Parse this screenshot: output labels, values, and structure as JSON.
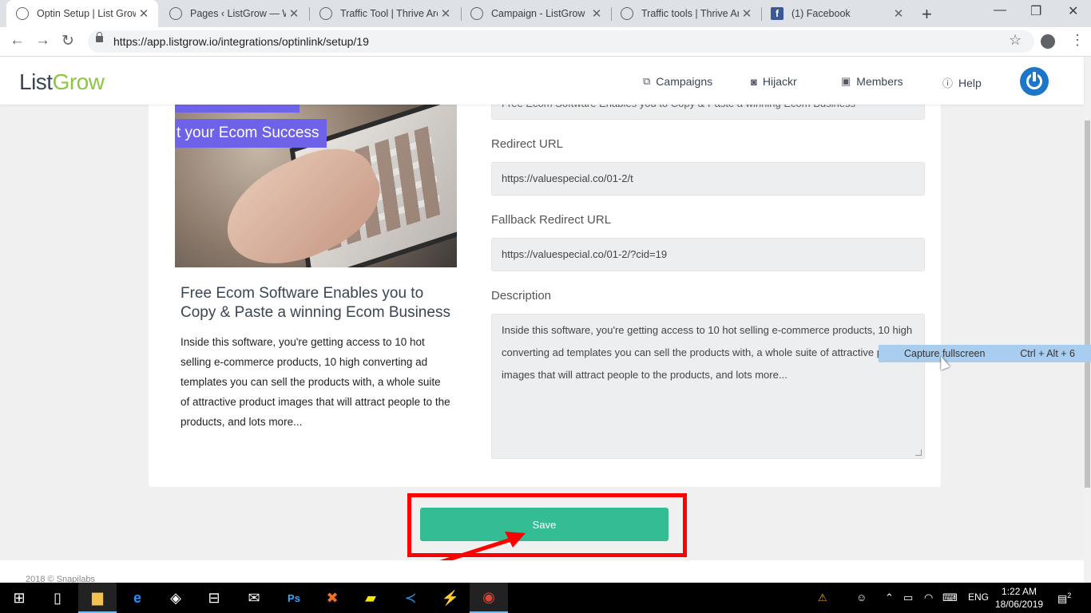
{
  "browser": {
    "tabs": [
      {
        "title": "Optin Setup | List Grow"
      },
      {
        "title": "Pages ‹ ListGrow — Wo"
      },
      {
        "title": "Traffic Tool | Thrive Arch"
      },
      {
        "title": "Campaign - ListGrow"
      },
      {
        "title": "Traffic tools | Thrive Arch"
      },
      {
        "title": "(1) Facebook"
      }
    ],
    "url": "https://app.listgrow.io/integrations/optinlink/setup/19"
  },
  "app": {
    "logo_list": "List",
    "logo_grow": "Grow",
    "nav": [
      {
        "label": "Campaigns",
        "icon": "campaigns-icon"
      },
      {
        "label": "Hijackr",
        "icon": "camera-icon"
      },
      {
        "label": "Members",
        "icon": "members-card-icon"
      },
      {
        "label": "Help",
        "icon": "info-icon"
      }
    ]
  },
  "product": {
    "banner": "t your Ecom Success",
    "title": "Free Ecom Software Enables you to Copy & Paste a winning Ecom Business",
    "description": "Inside this software, you're getting access to 10 hot selling e-commerce products, 10 high converting ad templates you can sell the products with, a whole suite of attractive product images that will attract people to the products, and lots more..."
  },
  "form": {
    "title_value": "Free Ecom Software Enables you to Copy & Paste a winning Ecom Business",
    "redirect_label": "Redirect URL",
    "redirect_value": "https://valuespecial.co/01-2/t",
    "fallback_label": "Fallback Redirect URL",
    "fallback_value": "https://valuespecial.co/01-2/?cid=19",
    "description_label": "Description",
    "description_value": "Inside this software, you're getting access to 10 hot selling e-commerce products, 10 high converting ad templates you can sell the products with, a whole suite of attractive product images that will attract people to the products, and lots more...",
    "save_label": "Save"
  },
  "footer": {
    "text": "2018 © Snapilabs"
  },
  "capture": {
    "label": "Capture fullscreen",
    "shortcut": "Ctrl + Alt + 6"
  },
  "taskbar": {
    "language": "ENG",
    "time": "1:22 AM",
    "date": "18/06/2019",
    "notifications": "2"
  },
  "colors": {
    "accent": "#34bc95",
    "highlight": "#ff0000",
    "brand_green": "#8dc63f",
    "brand_blue": "#1d77c9"
  }
}
